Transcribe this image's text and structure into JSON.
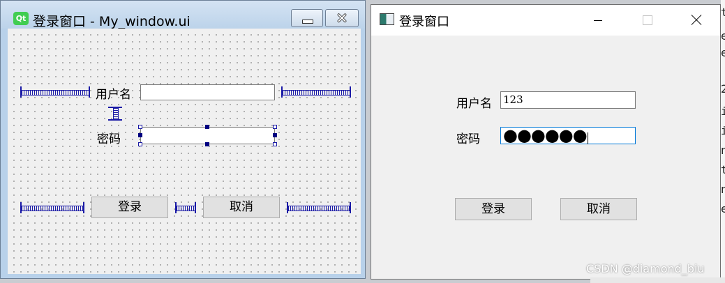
{
  "designer": {
    "logo": "Qt",
    "title": "登录窗口 - My_window.ui",
    "username_label": "用户名",
    "password_label": "密码",
    "login_button": "登录",
    "cancel_button": "取消"
  },
  "run_window": {
    "title": "登录窗口",
    "username_label": "用户名",
    "username_value": "123",
    "password_label": "密码",
    "password_masked": "●●●●●●",
    "login_button": "登录",
    "cancel_button": "取消"
  },
  "background_fragments": [
    "t",
    "er",
    "er",
    "2",
    "it",
    "it",
    "no",
    "t_",
    "no",
    "er"
  ],
  "watermark": "CSDN @diamond_biu",
  "colors": {
    "qt_green": "#41cd52",
    "spacer_blue": "#1a1aa6",
    "focus_border": "#0078d7"
  }
}
